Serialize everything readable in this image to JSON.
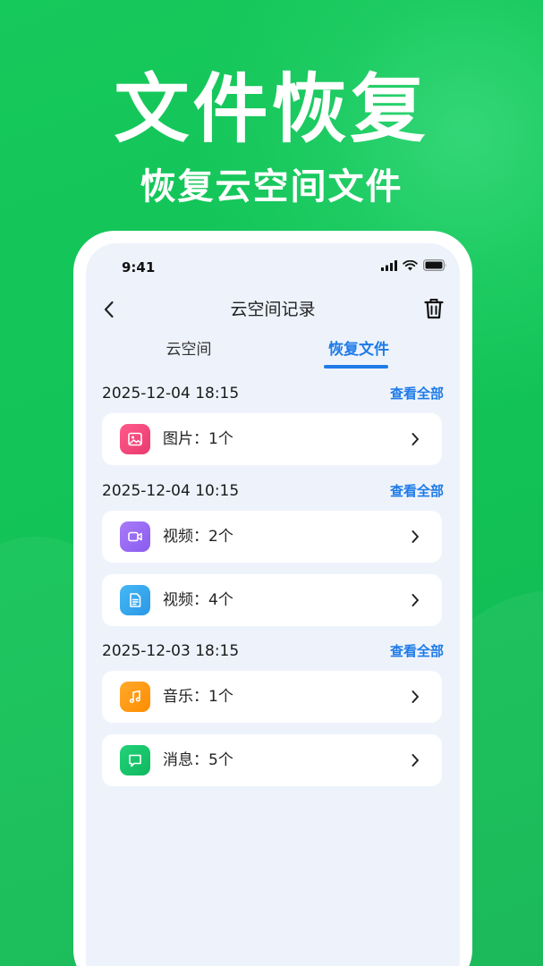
{
  "hero": {
    "title": "文件恢复",
    "subtitle": "恢复云空间文件"
  },
  "status_bar": {
    "time": "9:41"
  },
  "nav": {
    "title": "云空间记录",
    "back_icon": "chevron-left-icon",
    "delete_icon": "trash-icon"
  },
  "tabs": [
    {
      "label": "云空间",
      "active": false
    },
    {
      "label": "恢复文件",
      "active": true
    }
  ],
  "groups": [
    {
      "date": "2025-12-04 18:15",
      "link": "查看全部",
      "items": [
        {
          "label": "图片：1个",
          "icon": "image-icon",
          "color": "#f0457d"
        }
      ]
    },
    {
      "date": "2025-12-04 10:15",
      "link": "查看全部",
      "items": [
        {
          "label": "视频：2个",
          "icon": "video-icon",
          "color": "#9a6cf2"
        },
        {
          "label": "视频：4个",
          "icon": "document-icon",
          "color": "#35a8ef"
        }
      ]
    },
    {
      "date": "2025-12-03 18:15",
      "link": "查看全部",
      "items": [
        {
          "label": "音乐：1个",
          "icon": "music-icon",
          "color": "#ff9a12"
        },
        {
          "label": "消息：5个",
          "icon": "message-icon",
          "color": "#14c46a"
        }
      ]
    }
  ],
  "colors": {
    "accent": "#1f7be8",
    "background": "#12c257",
    "screen_bg": "#eef3fb"
  }
}
